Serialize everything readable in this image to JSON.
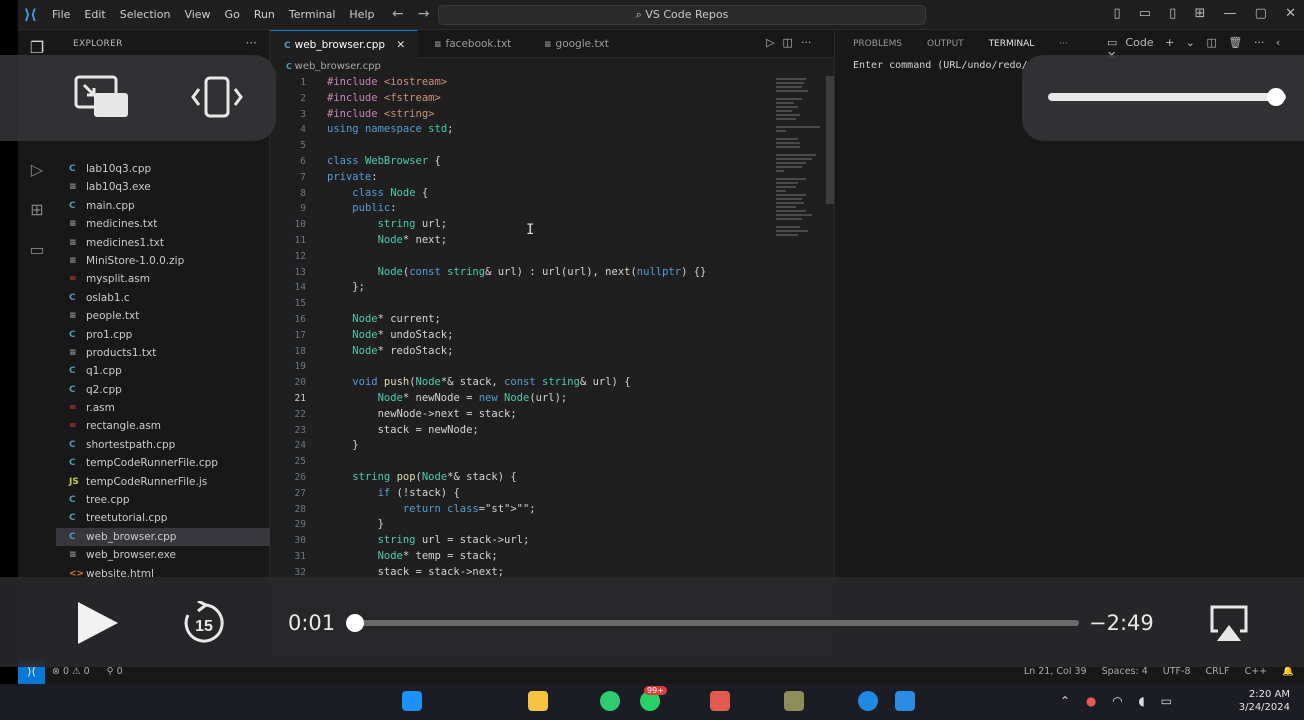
{
  "titlebar": {
    "menu": [
      "File",
      "Edit",
      "Selection",
      "View",
      "Go",
      "Run",
      "Terminal",
      "Help"
    ],
    "search": "VS Code Repos"
  },
  "explorer": {
    "header": "EXPLORER",
    "files": [
      {
        "name": "lab10q3.cpp",
        "icon": "C",
        "color": "#519aba"
      },
      {
        "name": "lab10q3.exe",
        "icon": "≡",
        "color": "#9d9d9d"
      },
      {
        "name": "main.cpp",
        "icon": "C",
        "color": "#519aba"
      },
      {
        "name": "medicines.txt",
        "icon": "≡",
        "color": "#9d9d9d"
      },
      {
        "name": "medicines1.txt",
        "icon": "≡",
        "color": "#9d9d9d"
      },
      {
        "name": "MiniStore-1.0.0.zip",
        "icon": "≡",
        "color": "#9d9d9d"
      },
      {
        "name": "mysplit.asm",
        "icon": "=",
        "color": "#cc3e44"
      },
      {
        "name": "oslab1.c",
        "icon": "C",
        "color": "#519aba"
      },
      {
        "name": "people.txt",
        "icon": "≡",
        "color": "#9d9d9d"
      },
      {
        "name": "pro1.cpp",
        "icon": "C",
        "color": "#519aba"
      },
      {
        "name": "products1.txt",
        "icon": "≡",
        "color": "#9d9d9d"
      },
      {
        "name": "q1.cpp",
        "icon": "C",
        "color": "#519aba"
      },
      {
        "name": "q2.cpp",
        "icon": "C",
        "color": "#519aba"
      },
      {
        "name": "r.asm",
        "icon": "=",
        "color": "#cc3e44"
      },
      {
        "name": "rectangle.asm",
        "icon": "=",
        "color": "#cc3e44"
      },
      {
        "name": "shortestpath.cpp",
        "icon": "C",
        "color": "#519aba"
      },
      {
        "name": "tempCodeRunnerFile.cpp",
        "icon": "C",
        "color": "#519aba"
      },
      {
        "name": "tempCodeRunnerFile.js",
        "icon": "JS",
        "color": "#cbcb41"
      },
      {
        "name": "tree.cpp",
        "icon": "C",
        "color": "#519aba"
      },
      {
        "name": "treetutorial.cpp",
        "icon": "C",
        "color": "#519aba"
      },
      {
        "name": "web_browser.cpp",
        "icon": "C",
        "color": "#519aba",
        "selected": true
      },
      {
        "name": "web_browser.exe",
        "icon": "≡",
        "color": "#9d9d9d"
      },
      {
        "name": "website.html",
        "icon": "<>",
        "color": "#e37933"
      }
    ]
  },
  "tabs": [
    {
      "label": "web_browser.cpp",
      "active": true
    },
    {
      "label": "facebook.txt",
      "active": false
    },
    {
      "label": "google.txt",
      "active": false
    }
  ],
  "breadcrumb": "web_browser.cpp",
  "code": {
    "line_numbers": [
      "1",
      "2",
      "3",
      "4",
      "5",
      "6",
      "7",
      "8",
      "9",
      "10",
      "11",
      "12",
      "13",
      "14",
      "15",
      "16",
      "17",
      "18",
      "19",
      "20",
      "21",
      "22",
      "23",
      "24",
      "25",
      "26",
      "27",
      "28",
      "29",
      "30",
      "31",
      "32"
    ],
    "lines": [
      "#include <iostream>",
      "#include <fstream>",
      "#include <string>",
      "using namespace std;",
      "",
      "class WebBrowser {",
      "private:",
      "    class Node {",
      "    public:",
      "        string url;",
      "        Node* next;",
      "",
      "        Node(const string& url) : url(url), next(nullptr) {}",
      "    };",
      "",
      "    Node* current;",
      "    Node* undoStack;",
      "    Node* redoStack;",
      "",
      "    void push(Node*& stack, const string& url) {",
      "        Node* newNode = new Node(url);",
      "        newNode->next = stack;",
      "        stack = newNode;",
      "    }",
      "",
      "    string pop(Node*& stack) {",
      "        if (!stack) {",
      "            return \"\";",
      "        }",
      "        string url = stack->url;",
      "        Node* temp = stack;",
      "        stack = stack->next;"
    ]
  },
  "panel": {
    "tabs": [
      "PROBLEMS",
      "OUTPUT",
      "TERMINAL"
    ],
    "active_tab": "TERMINAL",
    "shell": "Code",
    "terminal_text": "Enter command (URL/undo/redo/"
  },
  "statusbar": {
    "errors": "⊗ 0 ⚠ 0",
    "ports": "⚲ 0",
    "position": "Ln 21, Col 39",
    "spaces": "Spaces: 4",
    "encoding": "UTF-8",
    "eol": "CRLF",
    "language": "C++"
  },
  "taskbar": {
    "time": "2:20 AM",
    "date": "3/24/2024",
    "badge": "99+"
  },
  "player": {
    "elapsed": "0:01",
    "remaining": "−2:49",
    "progress": 0.006,
    "volume": 0.96
  }
}
